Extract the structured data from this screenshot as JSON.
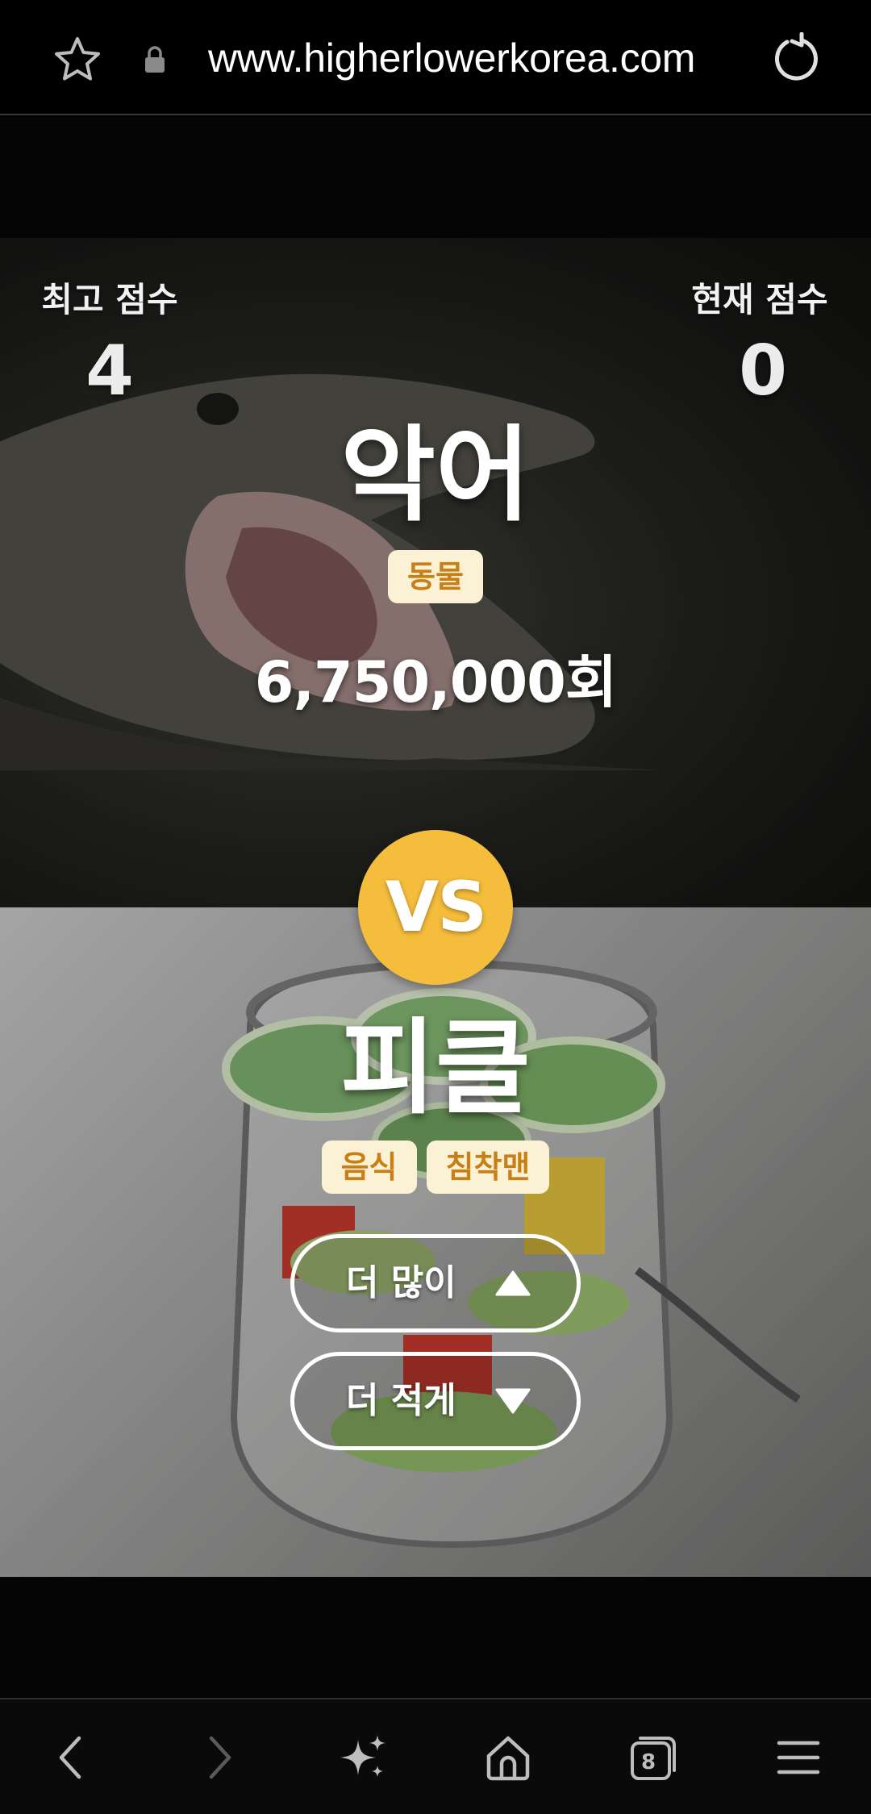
{
  "browser": {
    "url": "www.higherlowerkorea.com",
    "icons": {
      "bookmark": "star-icon",
      "security": "lock-icon",
      "reload": "reload-icon"
    }
  },
  "game": {
    "best_score_label": "최고 점수",
    "best_score": "4",
    "current_score_label": "현재 점수",
    "current_score": "0",
    "vs_label": "VS",
    "top_item": {
      "name": "악어",
      "tags": [
        "동물"
      ],
      "count": "6,750,000회"
    },
    "bottom_item": {
      "name": "피클",
      "tags": [
        "음식",
        "침착맨"
      ]
    },
    "buttons": {
      "higher_label": "더 많이",
      "lower_label": "더 적게"
    },
    "colors": {
      "vs_circle": "#f5bd3c",
      "tag_background": "#fbf1d4",
      "tag_text": "#c77f17"
    }
  },
  "navbar": {
    "tab_count": "8",
    "icons": [
      "back-icon",
      "forward-icon",
      "sparkle-icon",
      "home-icon",
      "tabs-icon",
      "menu-icon"
    ]
  }
}
